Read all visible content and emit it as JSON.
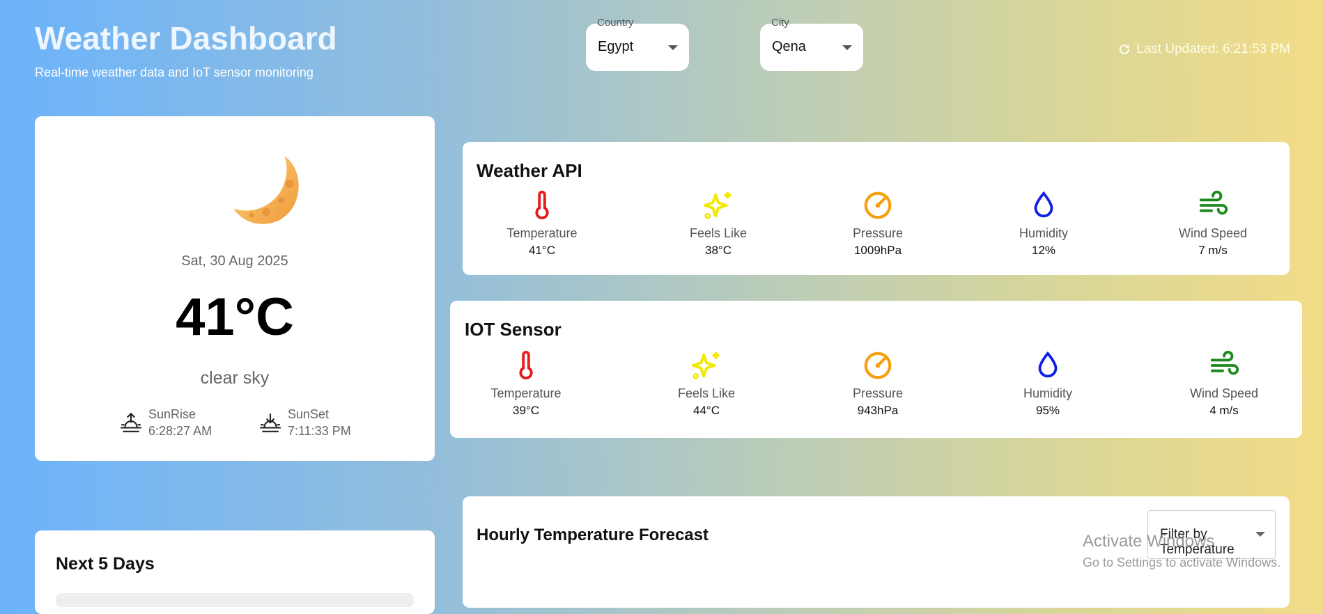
{
  "header": {
    "title": "Weather Dashboard",
    "subtitle": "Real-time weather data and IoT sensor monitoring",
    "last_updated": "Last Updated: 6:21:53 PM"
  },
  "selectors": {
    "country": {
      "label": "Country",
      "value": "Egypt"
    },
    "city": {
      "label": "City",
      "value": "Qena"
    }
  },
  "current": {
    "icon": "crescent-moon-icon",
    "date": "Sat, 30 Aug 2025",
    "temperature": "41°C",
    "description": "clear sky",
    "sunrise": {
      "label": "SunRise",
      "time": "6:28:27 AM"
    },
    "sunset": {
      "label": "SunSet",
      "time": "7:11:33 PM"
    }
  },
  "weather_api": {
    "title": "Weather API",
    "metrics": [
      {
        "label": "Temperature",
        "value": "41°C",
        "icon": "thermometer-icon",
        "color": "#e8191b"
      },
      {
        "label": "Feels Like",
        "value": "38°C",
        "icon": "sparkle-icon",
        "color": "#f2e800"
      },
      {
        "label": "Pressure",
        "value": "1009hPa",
        "icon": "gauge-icon",
        "color": "#f5a00f"
      },
      {
        "label": "Humidity",
        "value": "12%",
        "icon": "droplet-icon",
        "color": "#1020e0"
      },
      {
        "label": "Wind Speed",
        "value": "7 m/s",
        "icon": "wind-icon",
        "color": "#1e8a1e"
      }
    ]
  },
  "iot_sensor": {
    "title": "IOT Sensor",
    "metrics": [
      {
        "label": "Temperature",
        "value": "39°C",
        "icon": "thermometer-icon",
        "color": "#e8191b"
      },
      {
        "label": "Feels Like",
        "value": "44°C",
        "icon": "sparkle-icon",
        "color": "#f2e800"
      },
      {
        "label": "Pressure",
        "value": "943hPa",
        "icon": "gauge-icon",
        "color": "#f5a00f"
      },
      {
        "label": "Humidity",
        "value": "95%",
        "icon": "droplet-icon",
        "color": "#1020e0"
      },
      {
        "label": "Wind Speed",
        "value": "4 m/s",
        "icon": "wind-icon",
        "color": "#1e8a1e"
      }
    ]
  },
  "next_days": {
    "title": "Next 5 Days"
  },
  "hourly": {
    "title": "Hourly Temperature Forecast",
    "filter_value": "Filter by Temperature"
  },
  "watermark": {
    "title": "Activate Windows",
    "subtitle": "Go to Settings to activate Windows."
  }
}
